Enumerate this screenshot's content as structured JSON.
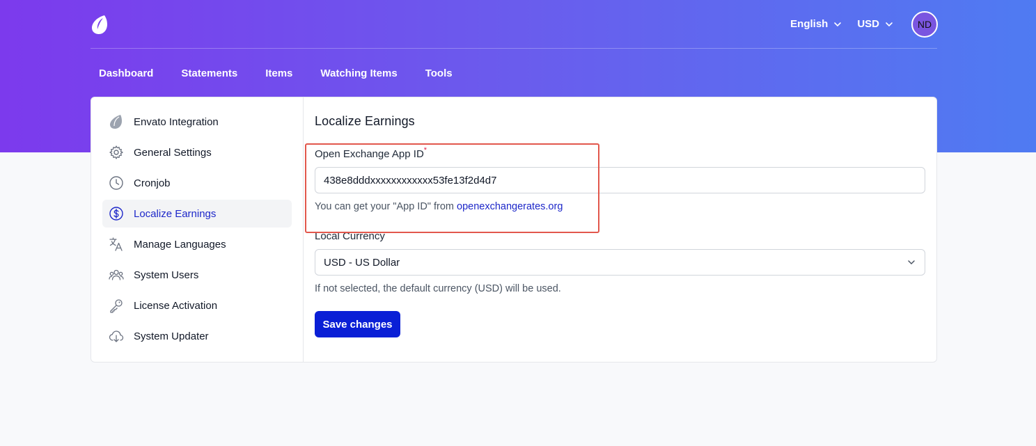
{
  "header": {
    "language": "English",
    "currency": "USD",
    "avatar_initials": "ND"
  },
  "nav": {
    "items": [
      "Dashboard",
      "Statements",
      "Items",
      "Watching Items",
      "Tools"
    ]
  },
  "sidebar": {
    "items": [
      {
        "label": "Envato Integration",
        "icon": "envato-leaf-icon"
      },
      {
        "label": "General Settings",
        "icon": "gear-icon"
      },
      {
        "label": "Cronjob",
        "icon": "clock-icon"
      },
      {
        "label": "Localize Earnings",
        "icon": "dollar-circle-icon",
        "active": true
      },
      {
        "label": "Manage Languages",
        "icon": "translate-icon"
      },
      {
        "label": "System Users",
        "icon": "users-icon"
      },
      {
        "label": "License Activation",
        "icon": "key-icon"
      },
      {
        "label": "System Updater",
        "icon": "cloud-download-icon"
      }
    ]
  },
  "main": {
    "title": "Localize Earnings",
    "app_id_label": "Open Exchange App ID",
    "app_id_required": "*",
    "app_id_value": "438e8dddxxxxxxxxxxxx53fe13f2d4d7",
    "app_id_help_prefix": "You can get your \"App ID\" from ",
    "app_id_help_link": "openexchangerates.org",
    "currency_label": "Local Currency",
    "currency_value": "USD - US Dollar",
    "currency_help": "If not selected, the default currency (USD) will be used.",
    "save_label": "Save changes"
  },
  "colors": {
    "accent": "#0a1fd6",
    "highlight_border": "#e2574c",
    "gradient_start": "#7c3aed",
    "gradient_end": "#4f7bf2"
  }
}
